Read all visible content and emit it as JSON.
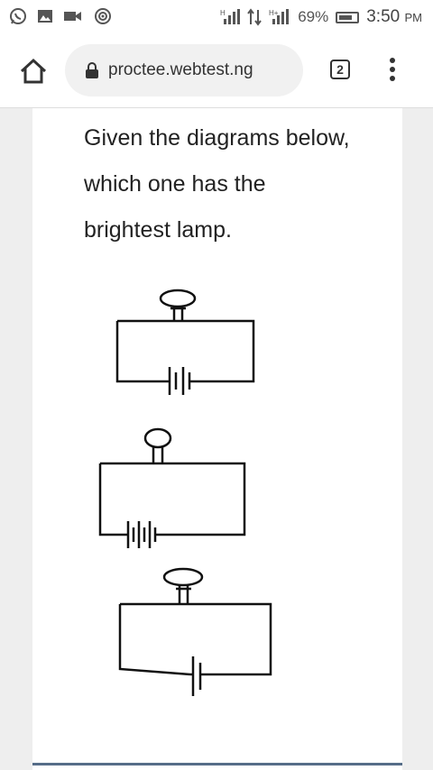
{
  "status_bar": {
    "battery": "69%",
    "time": "3:50",
    "time_suffix": "PM",
    "icons": [
      "whatsapp-icon",
      "gallery-icon",
      "video-call-icon",
      "hotspot-icon",
      "signal-h-icon",
      "data-arrows-icon",
      "signal-h-plus-icon",
      "battery-icon"
    ]
  },
  "browser": {
    "url": "proctee.webtest.ng",
    "tab_count": "2",
    "icons": [
      "home-icon",
      "lock-icon",
      "more-vert-icon"
    ]
  },
  "question": {
    "text": "Given the diagrams below, which one has the brightest lamp."
  },
  "diagrams": {
    "count": 3,
    "cells_per_circuit": [
      2,
      3,
      1
    ],
    "element_icons": [
      "lamp-icon",
      "battery-cell-icon",
      "wire"
    ]
  }
}
